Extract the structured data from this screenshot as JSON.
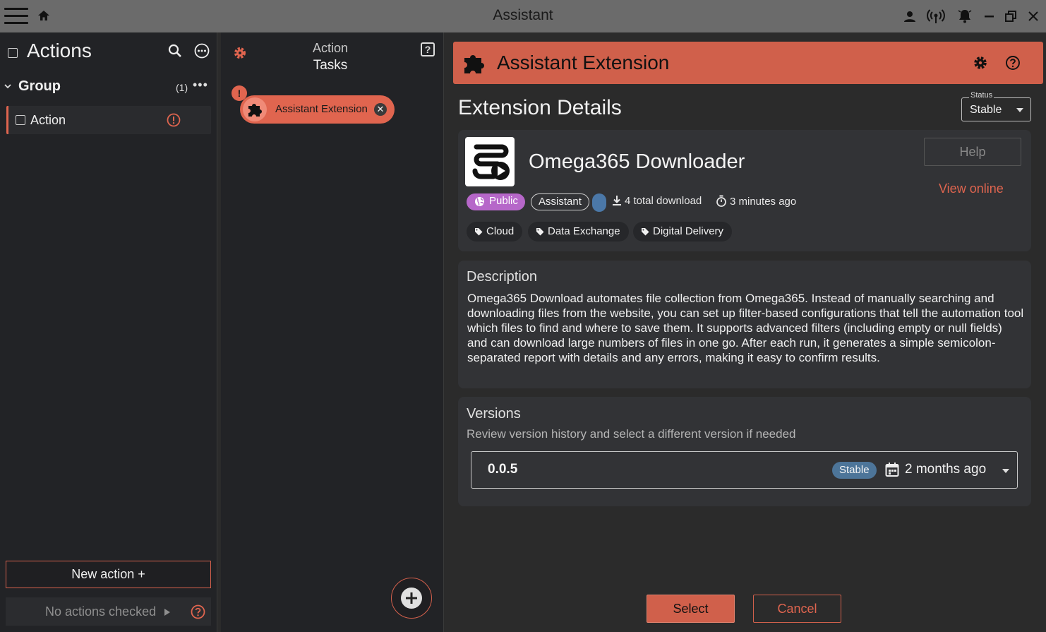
{
  "window": {
    "title": "Assistant",
    "icons": [
      "menu-icon",
      "home-icon",
      "user-icon",
      "broadcast-icon",
      "bell-icon",
      "minimize-icon",
      "restore-icon",
      "close-icon"
    ]
  },
  "left_panel": {
    "title": "Actions",
    "group": {
      "name": "Group",
      "count": "(1)",
      "more": "•••"
    },
    "action": {
      "label": "Action"
    },
    "new_action": "New action +",
    "no_actions": "No actions checked"
  },
  "middle_panel": {
    "title_line1": "Action",
    "title_line2": "Tasks",
    "help": "?",
    "warning": "!",
    "chip_label": "Assistant Extension",
    "chip_close": "✕"
  },
  "right_panel": {
    "header_title": "Assistant Extension",
    "details_title": "Extension Details",
    "status": {
      "label": "Status",
      "value": "Stable"
    },
    "extension": {
      "name": "Omega365 Downloader",
      "help_button": "Help",
      "view_online": "View online",
      "visibility_badge": "Public",
      "type_badge": "Assistant",
      "downloads": "4 total download",
      "updated": "3 minutes ago",
      "tags": [
        "Cloud",
        "Data Exchange",
        "Digital Delivery"
      ]
    },
    "description": {
      "title": "Description",
      "text": "Omega365 Download automates file collection from Omega365. Instead of manually searching and downloading files from the website, you can set up filter-based configurations that tell the automation tool which files to find and where to save them. It supports advanced filters (including empty or null fields) and can download large numbers of files in one go. After each run, it generates a simple semicolon-separated report with details and any errors, making it easy to confirm results."
    },
    "versions": {
      "title": "Versions",
      "subtitle": "Review version history and select a different version if needed",
      "selected_version": "0.0.5",
      "selected_badge": "Stable",
      "selected_date": "2 months ago"
    },
    "select_button": "Select",
    "cancel_button": "Cancel"
  },
  "colors": {
    "accent": "#d0604b",
    "accent_light": "#e0654f",
    "public_badge": "#b667c9",
    "stable_badge": "#4d7599",
    "titlebar": "#6b6b6b"
  }
}
